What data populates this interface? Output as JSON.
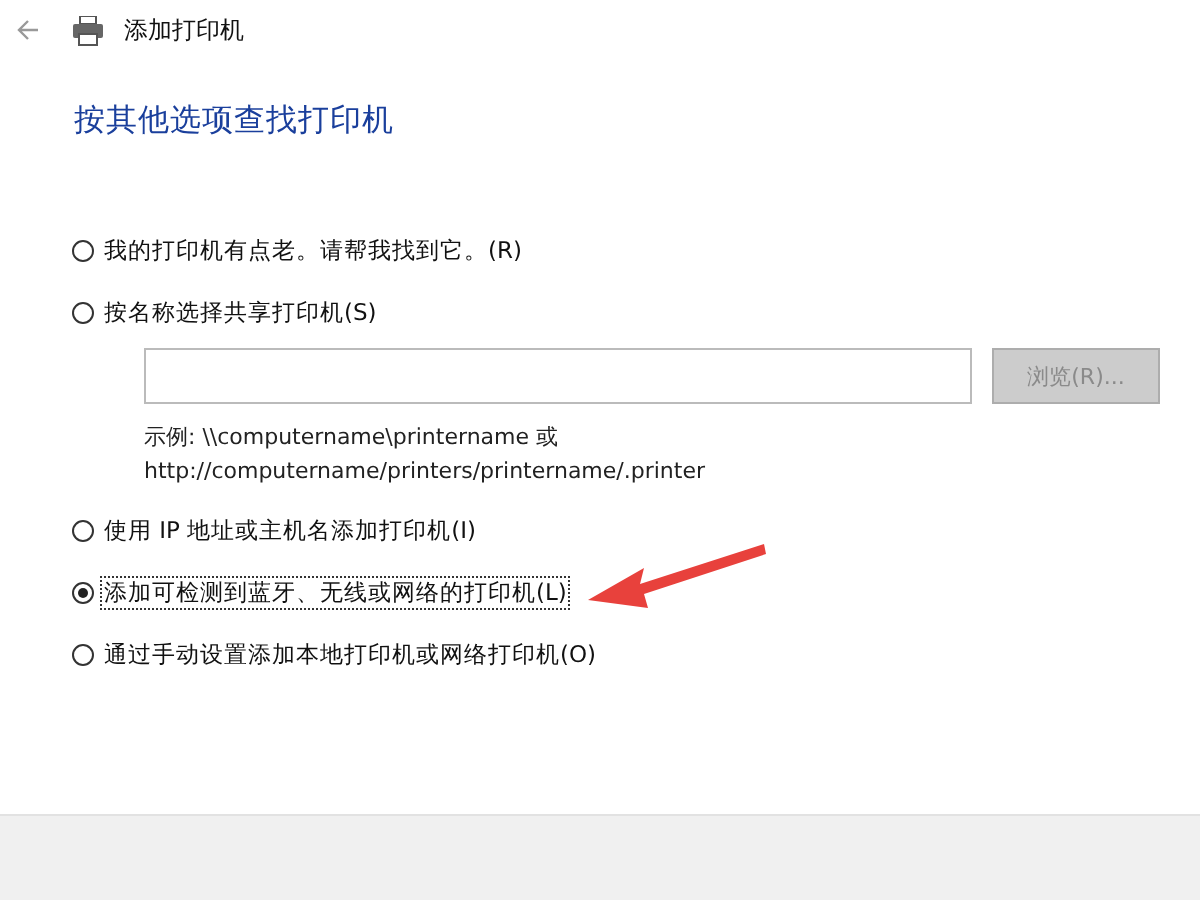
{
  "window": {
    "title": "添加打印机"
  },
  "heading": "按其他选项查找打印机",
  "options": [
    {
      "label": "我的打印机有点老。请帮我找到它。(R)",
      "selected": false,
      "focused": false
    },
    {
      "label": "按名称选择共享打印机(S)",
      "selected": false,
      "focused": false,
      "browse_button": {
        "label": "浏览(R)...",
        "disabled": true
      },
      "example": [
        "示例: \\\\computername\\printername 或",
        "http://computername/printers/printername/.printer"
      ]
    },
    {
      "label": "使用 IP 地址或主机名添加打印机(I)",
      "selected": false,
      "focused": false
    },
    {
      "label": "添加可检测到蓝牙、无线或网络的打印机(L)",
      "selected": true,
      "focused": true
    },
    {
      "label": "通过手动设置添加本地打印机或网络打印机(O)",
      "selected": false,
      "focused": false
    }
  ]
}
